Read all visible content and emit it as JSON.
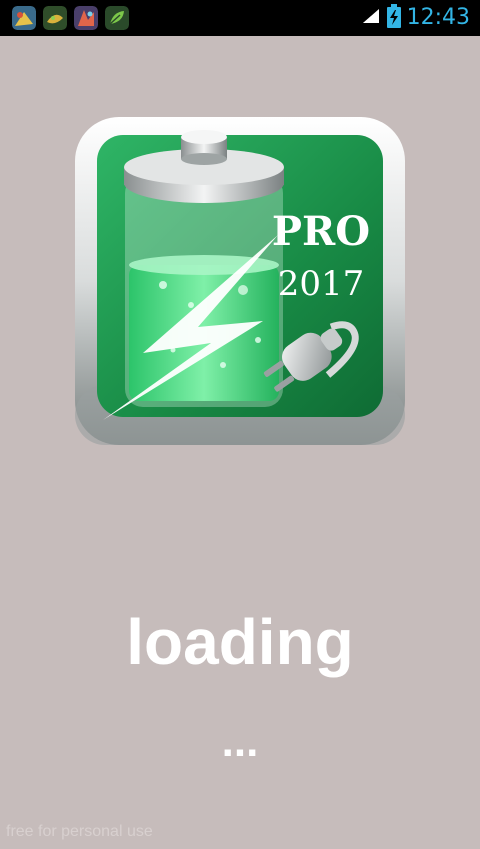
{
  "status_bar": {
    "time": "12:43",
    "notification_icons": [
      "app-notification-icon",
      "app-notification-icon",
      "app-notification-icon",
      "app-notification-icon"
    ],
    "signal_icon": "signal-icon",
    "battery_icon": "battery-charging-icon",
    "time_color": "#33b5e5"
  },
  "splash": {
    "logo": {
      "badge_line1": "PRO",
      "badge_line2": "2017"
    },
    "loading_label": "loading",
    "dots_label": "...",
    "watermark": "free for personal use"
  },
  "colors": {
    "background": "#c6bcbb",
    "accent_green": "#1e9a4f",
    "text": "#ffffff"
  }
}
